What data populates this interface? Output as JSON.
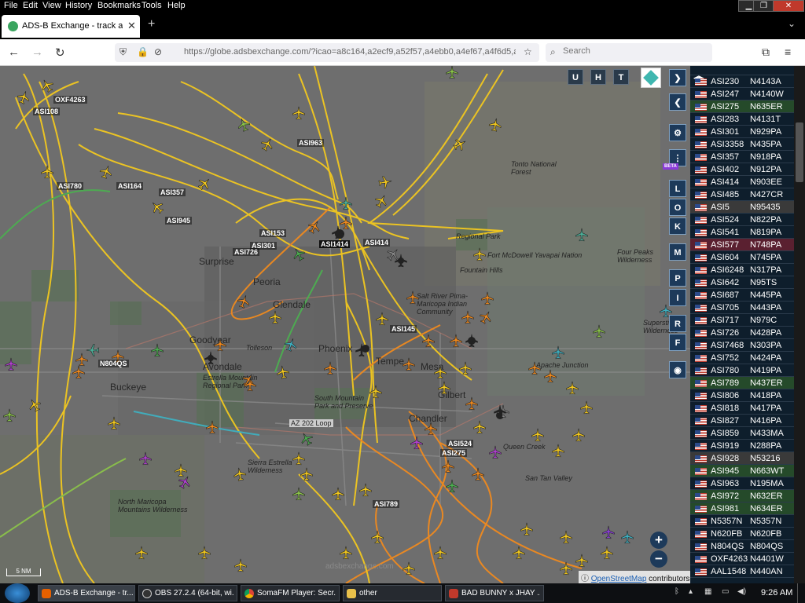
{
  "menu": {
    "items": [
      "File",
      "Edit",
      "View",
      "History",
      "Bookmarks",
      "Tools",
      "Help"
    ]
  },
  "window_controls": {
    "minimize": "▁",
    "maximize": "❐",
    "close": "✕"
  },
  "tab": {
    "title": "ADS-B Exchange - track aircraft",
    "close": "✕",
    "new_tab": "+",
    "list_all": "⌄"
  },
  "nav": {
    "url": "https://globe.adsbexchange.com/?icao=a8c164,a2ecf9,a52f57,a4ebb0,a4ef67,a4f6d5,a",
    "search_placeholder": "Search"
  },
  "map": {
    "top_buttons": [
      "U",
      "H",
      "T"
    ],
    "side_buttons": [
      "L",
      "O",
      "K",
      "M",
      "P",
      "I",
      "R",
      "F"
    ],
    "beta_badge": "BETA",
    "zoom_in": "+",
    "zoom_out": "−",
    "scale_label": "5 NM",
    "watermark": "adsbexchange.com",
    "attribution": {
      "link": "OpenStreetMap",
      "suffix": "contributors."
    },
    "places": [
      {
        "text": "Phoenix",
        "big": true
      },
      {
        "text": "Tempe",
        "big": true
      },
      {
        "text": "Mesa",
        "big": true
      },
      {
        "text": "Gilbert",
        "big": true
      },
      {
        "text": "Chandler",
        "big": true
      },
      {
        "text": "Glendale",
        "big": true
      },
      {
        "text": "Peoria",
        "big": true
      },
      {
        "text": "Surprise",
        "big": true
      },
      {
        "text": "Buckeye",
        "big": true
      },
      {
        "text": "Goodyear",
        "big": true
      },
      {
        "text": "Avondale",
        "big": true
      },
      {
        "text": "Tolleson",
        "big": false
      },
      {
        "text": "Fountain Hills",
        "big": false
      },
      {
        "text": "Fort McDowell Yavapai Nation",
        "big": false
      },
      {
        "text": "Salt River Pima-Maricopa Indian Community",
        "big": false
      },
      {
        "text": "Tonto National Forest",
        "big": false
      },
      {
        "text": "Four Peaks Wilderness",
        "big": false
      },
      {
        "text": "Superstition Wilderness",
        "big": false
      },
      {
        "text": "Estrella Mountain Regional Park",
        "big": false
      },
      {
        "text": "South Mountain Park and Preserve",
        "big": false
      },
      {
        "text": "Sierra Estrella Wilderness",
        "big": false
      },
      {
        "text": "North Maricopa Mountains Wilderness",
        "big": false
      },
      {
        "text": "Apache Junction",
        "big": false
      },
      {
        "text": "Queen Creek",
        "big": false
      },
      {
        "text": "San Tan Valley",
        "big": false
      },
      {
        "text": "Regional Park",
        "big": false
      },
      {
        "text": "AZ 202 Loop",
        "big": false
      }
    ],
    "aircraft_labels": [
      "OXF4263",
      "ASI108",
      "ASI780",
      "ASI164",
      "ASI357",
      "ASI945",
      "ASI963",
      "ASI153",
      "ASI301",
      "ASI726",
      "ASI1414",
      "ASI414",
      "ASI145",
      "N804QS",
      "ASI524",
      "ASI275",
      "ASI789"
    ]
  },
  "sidebar_list": [
    {
      "c1": "ASI230",
      "c2": "N4143A"
    },
    {
      "c1": "ASI247",
      "c2": "N4140W"
    },
    {
      "c1": "ASI275",
      "c2": "N635ER"
    },
    {
      "c1": "ASI283",
      "c2": "N4131T"
    },
    {
      "c1": "ASI301",
      "c2": "N929PA"
    },
    {
      "c1": "ASI3358",
      "c2": "N435PA"
    },
    {
      "c1": "ASI357",
      "c2": "N918PA"
    },
    {
      "c1": "ASI402",
      "c2": "N912PA"
    },
    {
      "c1": "ASI414",
      "c2": "N903EE"
    },
    {
      "c1": "ASI485",
      "c2": "N427CR"
    },
    {
      "c1": "ASI5",
      "c2": "N95435"
    },
    {
      "c1": "ASI524",
      "c2": "N822PA"
    },
    {
      "c1": "ASI541",
      "c2": "N819PA"
    },
    {
      "c1": "ASI577",
      "c2": "N748PA"
    },
    {
      "c1": "ASI604",
      "c2": "N745PA"
    },
    {
      "c1": "ASI6248",
      "c2": "N317PA"
    },
    {
      "c1": "ASI642",
      "c2": "N95TS"
    },
    {
      "c1": "ASI687",
      "c2": "N445PA"
    },
    {
      "c1": "ASI705",
      "c2": "N443PA"
    },
    {
      "c1": "ASI717",
      "c2": "N979C"
    },
    {
      "c1": "ASI726",
      "c2": "N428PA"
    },
    {
      "c1": "ASI7468",
      "c2": "N303PA"
    },
    {
      "c1": "ASI752",
      "c2": "N424PA"
    },
    {
      "c1": "ASI780",
      "c2": "N419PA"
    },
    {
      "c1": "ASI789",
      "c2": "N437ER"
    },
    {
      "c1": "ASI806",
      "c2": "N418PA"
    },
    {
      "c1": "ASI818",
      "c2": "N417PA"
    },
    {
      "c1": "ASI827",
      "c2": "N416PA"
    },
    {
      "c1": "ASI859",
      "c2": "N433MA"
    },
    {
      "c1": "ASI919",
      "c2": "N288PA"
    },
    {
      "c1": "ASI928",
      "c2": "N53216"
    },
    {
      "c1": "ASI945",
      "c2": "N663WT"
    },
    {
      "c1": "ASI963",
      "c2": "N195MA"
    },
    {
      "c1": "ASI972",
      "c2": "N632ER"
    },
    {
      "c1": "ASI981",
      "c2": "N634ER"
    },
    {
      "c1": "N5357N",
      "c2": "N5357N"
    },
    {
      "c1": "N620FB",
      "c2": "N620FB"
    },
    {
      "c1": "N804QS",
      "c2": "N804QS"
    },
    {
      "c1": "OXF4263",
      "c2": "N4401W"
    },
    {
      "c1": "AAL1548",
      "c2": "N440AN"
    }
  ],
  "taskbar": {
    "items": [
      {
        "label": "ADS-B Exchange - tr..."
      },
      {
        "label": "OBS 27.2.4 (64-bit, wi..."
      },
      {
        "label": "SomaFM Player: Secr..."
      },
      {
        "label": "other"
      },
      {
        "label": "BAD BUNNY x JHAY ..."
      }
    ],
    "time": "9:26 AM"
  },
  "colors": {
    "track_yellow": "#f2c81f",
    "track_orange": "#f08a1e",
    "track_green": "#4caf50",
    "panel_bg": "#0e1e2c",
    "row_highlight_green": "#254a2a",
    "row_highlight_red": "#5a2030",
    "row_highlight_gray": "#3a3a3a"
  }
}
